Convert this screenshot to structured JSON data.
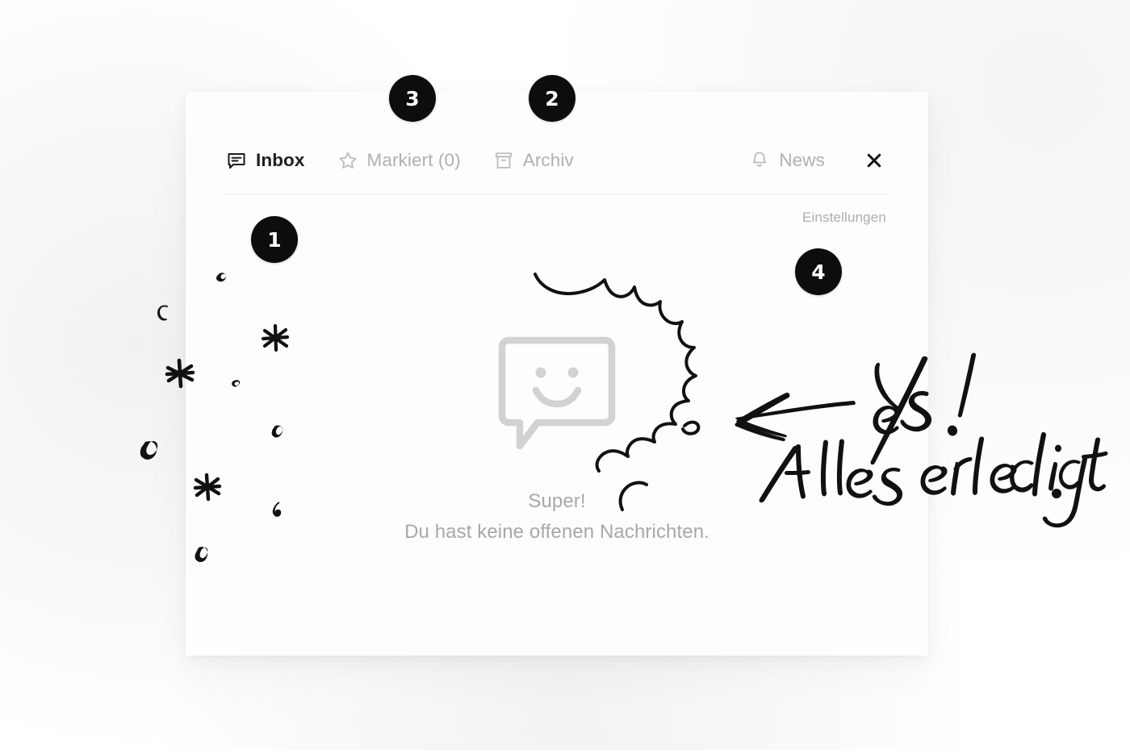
{
  "window": {
    "title": "Inbox",
    "background_color": "#ffffff",
    "card_color": "#fdfdfd"
  },
  "tabs": [
    {
      "id": "inbox",
      "label": "Inbox",
      "icon": "message-bubble-icon",
      "active": true,
      "color": "#1f1f1f"
    },
    {
      "id": "markiert",
      "label": "Markiert (0)",
      "icon": "star-icon",
      "active": false,
      "color": "#b0b0b0"
    },
    {
      "id": "archiv",
      "label": "Archiv",
      "icon": "archive-box-icon",
      "active": false,
      "color": "#b0b0b0"
    },
    {
      "id": "news",
      "label": "News",
      "icon": "bell-icon",
      "active": false,
      "color": "#b0b0b0"
    }
  ],
  "close_button": {
    "icon": "close-x-icon",
    "label": "×"
  },
  "settings": {
    "label": "Einstellungen",
    "color": "#adadad"
  },
  "empty_state": {
    "illustration": "smiley-speech-bubble-icon",
    "illustration_color": "#d2d2d2",
    "title": "Super!",
    "subtitle": "Du hast keine offenen Nachrichten.",
    "text_color": "#a8a8a8"
  },
  "annotations": {
    "badge_color": "#0d0d0d",
    "badge_text_color": "#ffffff",
    "badges": [
      {
        "number": "1",
        "target": "inbox-content-area"
      },
      {
        "number": "2",
        "target": "archiv-tab"
      },
      {
        "number": "3",
        "target": "markiert-tab"
      },
      {
        "number": "4",
        "target": "einstellungen-link"
      }
    ]
  },
  "doodles": {
    "ink_color": "#111111",
    "handwriting_line1": "Yes !",
    "handwriting_line2": "Alles erledigt.",
    "arrow": "hand-drawn-left-arrow",
    "sparkles": "hand-drawn-sparkles-and-circles",
    "burst": "hand-drawn-starburst-outline"
  }
}
